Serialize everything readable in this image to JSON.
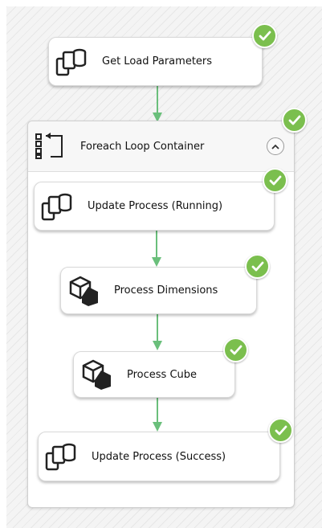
{
  "tasks": {
    "get_load_parameters": {
      "label": "Get Load Parameters",
      "icon": "sql-task-icon",
      "status": "success"
    },
    "update_process_running": {
      "label": "Update Process (Running)",
      "icon": "sql-task-icon",
      "status": "success"
    },
    "process_dimensions": {
      "label": "Process Dimensions",
      "icon": "analysis-services-processing-icon",
      "status": "success"
    },
    "process_cube": {
      "label": "Process Cube",
      "icon": "analysis-services-processing-icon",
      "status": "success"
    },
    "update_process_success": {
      "label": "Update Process (Success)",
      "icon": "sql-task-icon",
      "status": "success"
    }
  },
  "container": {
    "label": "Foreach Loop Container",
    "icon": "foreach-loop-icon",
    "status": "success",
    "collapse_icon": "chevron-up-icon"
  },
  "colors": {
    "success": "#7bbf4e",
    "connector": "#6abf7b"
  }
}
